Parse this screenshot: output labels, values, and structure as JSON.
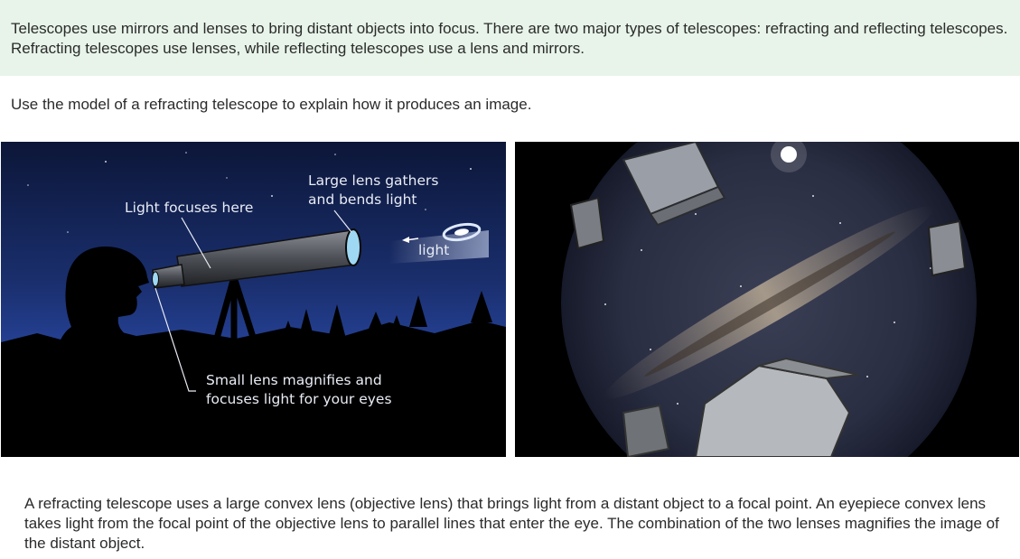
{
  "intro": {
    "text": "Telescopes use mirrors and lenses to bring distant objects into focus. There are two major types of telescopes: refracting and reflecting telescopes. Refracting telescopes use lenses, while reflecting telescopes use a lens and mirrors."
  },
  "prompt": {
    "text": "Use the model of a refracting telescope to explain how it produces an image."
  },
  "diagram": {
    "label_focus": "Light focuses here",
    "label_large_lens": "Large lens gathers\nand bends light",
    "label_light": "light",
    "label_small_lens": "Small lens magnifies and\nfocuses light for your eyes",
    "icons": [
      "galaxy-icon",
      "person-silhouette",
      "telescope",
      "tripod",
      "tree-line"
    ],
    "colors": {
      "sky_top": "#0c1638",
      "sky_bottom": "#3550b8",
      "lens": "#9fd8f2"
    }
  },
  "photo": {
    "subject": "fisheye-night-sky-observatory",
    "colors": {
      "background": "#000000"
    }
  },
  "explanation": {
    "text": "A refracting telescope uses a large convex lens (objective lens) that brings light from a distant object to a focal point. An eyepiece convex lens takes light from the focal point of the objective lens to parallel lines that enter the eye. The combination of the two lenses magnifies the image of the distant object."
  }
}
